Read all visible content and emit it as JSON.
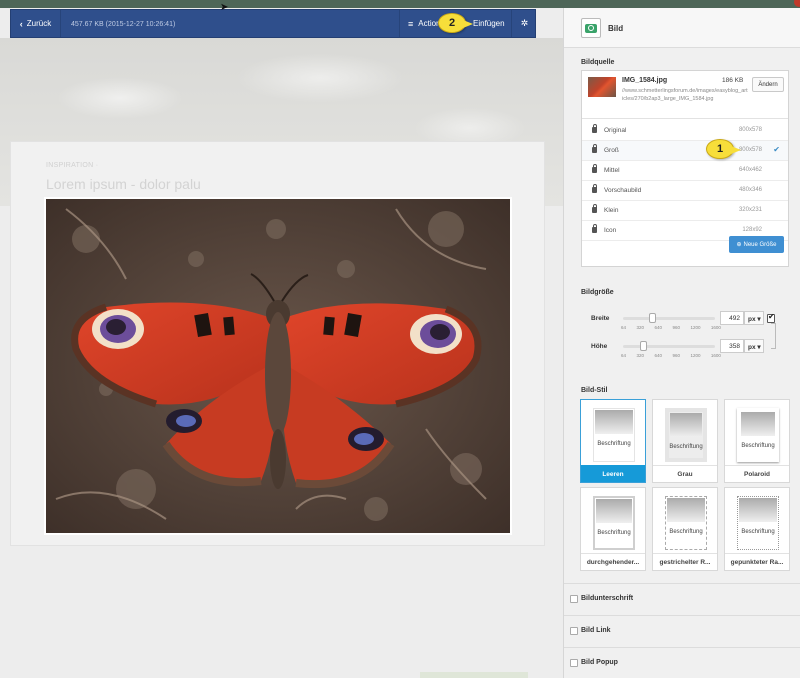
{
  "toolbar": {
    "back_label": "Zurück",
    "file_info": "457.67 KB (2015-12-27 10:26:41)",
    "actions_label": "Actions",
    "insert_label": "Einfügen"
  },
  "article": {
    "meta": "INSPIRATION  ·",
    "title": "Lorem ipsum - dolor palu"
  },
  "callouts": [
    "2",
    "1"
  ],
  "panel": {
    "title": "Bild",
    "source": {
      "section_title": "Bildquelle",
      "file_name": "IMG_1584.jpg",
      "file_size": "186 KB",
      "file_path": "//www.schmetterlingsforum.de/images/easyblog_articles/270/b2ap3_large_IMG_1584.jpg",
      "change_label": "Ändern"
    },
    "sizes": [
      {
        "name": "Original",
        "dim": "800x578",
        "selected": false
      },
      {
        "name": "Groß",
        "dim": "800x578",
        "selected": true
      },
      {
        "name": "Mittel",
        "dim": "640x462",
        "selected": false
      },
      {
        "name": "Vorschaubild",
        "dim": "480x346",
        "selected": false
      },
      {
        "name": "Klein",
        "dim": "320x231",
        "selected": false
      },
      {
        "name": "Icon",
        "dim": "128x92",
        "selected": false
      }
    ],
    "new_size_label": "Neue Größe",
    "dimensions": {
      "section_title": "Bildgröße",
      "width_label": "Breite",
      "height_label": "Höhe",
      "width_value": "492",
      "height_value": "358",
      "unit": "px",
      "ticks": [
        "64",
        "320",
        "640",
        "960",
        "1200",
        "1600"
      ],
      "width_fraction": 0.31,
      "height_fraction": 0.22
    },
    "style": {
      "section_title": "Bild-Stil",
      "caption_sample": "Beschriftung",
      "tiles": [
        {
          "label": "Leeren",
          "kind": "active"
        },
        {
          "label": "Grau",
          "kind": "grau"
        },
        {
          "label": "Polaroid",
          "kind": "polaroid"
        },
        {
          "label": "durchgehender...",
          "kind": "solid"
        },
        {
          "label": "gestrichelter R...",
          "kind": "dashed"
        },
        {
          "label": "gepunkteter Ra...",
          "kind": "dotted"
        }
      ]
    },
    "options": [
      "Bildunterschrift",
      "Bild Link",
      "Bild Popup"
    ]
  },
  "colors": {
    "toolbar": "#2f4f8c",
    "accent": "#169ad8",
    "callout": "#f7de3a"
  }
}
